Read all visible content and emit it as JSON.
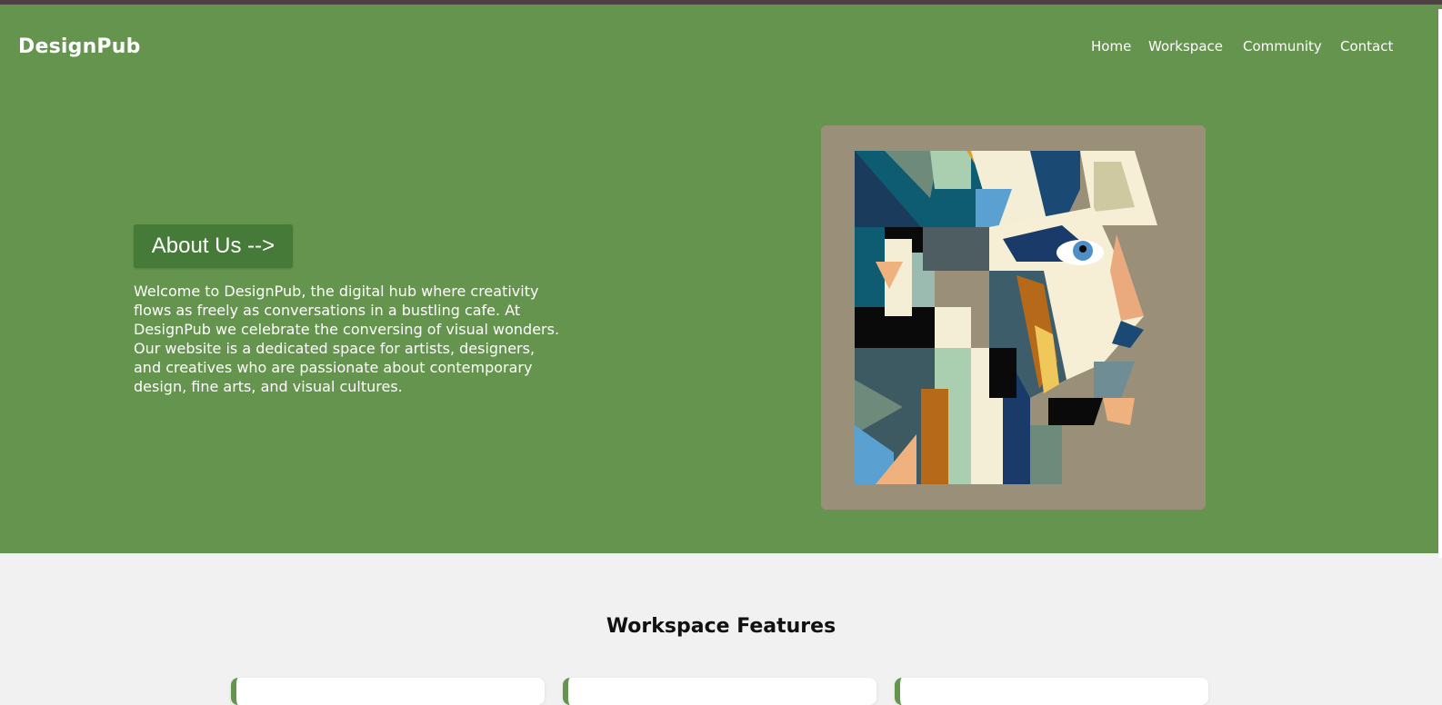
{
  "header": {
    "brand": "DesignPub",
    "nav": [
      "Home",
      "Workspace",
      "Community",
      "Contact"
    ]
  },
  "hero": {
    "button_label": "About Us -->",
    "intro_lines": [
      "Welcome to DesignPub, the digital hub where creativity",
      "flows as freely as conversations in a bustling cafe. At",
      "DesignPub we celebrate the conversing of visual wonders.",
      "Our website is a dedicated space for artists, designers,",
      "and creatives who are passionate about contemporary",
      "design, fine arts, and visual cultures."
    ],
    "image": "cubist-face-artwork"
  },
  "features": {
    "title": "Workspace Features",
    "cards": 3
  },
  "colors": {
    "hero_bg": "#64944d",
    "button_bg": "#457a38",
    "page_bg": "#f1f1f1",
    "top_strip": "#4c4043",
    "art_bg": "#9a8f79"
  }
}
